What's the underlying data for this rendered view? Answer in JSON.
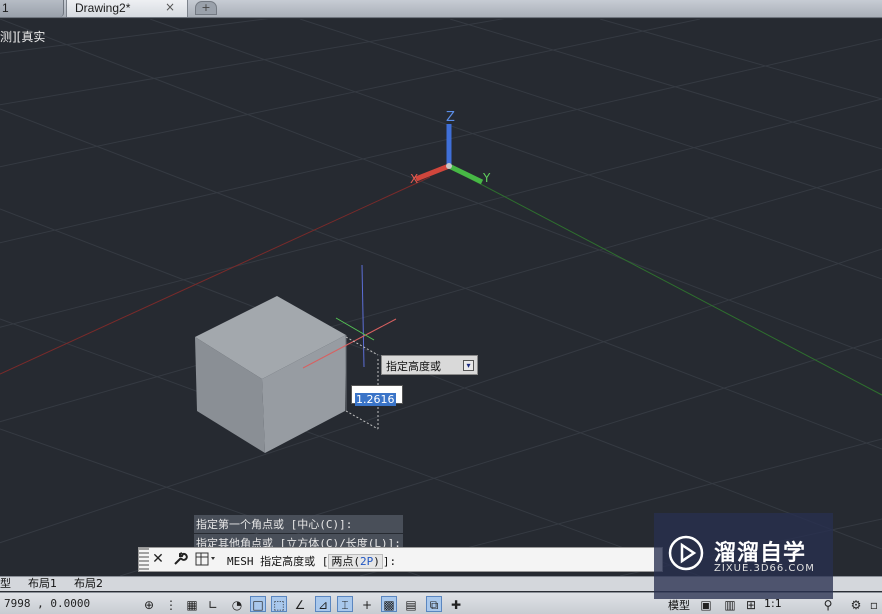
{
  "tabs": {
    "tab1_label": "1",
    "tab2_label": "Drawing2*",
    "close_glyph": "×",
    "new_glyph": "+"
  },
  "viewport": {
    "view_label": "测][真实",
    "axis_labels": {
      "x": "X",
      "y": "Y",
      "z": "Z"
    },
    "tooltip_text": "指定高度或",
    "tooltip_arrow": "▾",
    "dynamic_input_value": "1.2616"
  },
  "command_history": [
    "指定第一个角点或 [中心(C)]:",
    "指定其他角点或 [立方体(C)/长度(L)]:"
  ],
  "command_line": {
    "close_glyph": "✕",
    "wrench_glyph": "🔧",
    "prompt_prefix": "MESH 指定高度或 [",
    "option_label": "两点(",
    "option_key": "2P",
    "option_close": ")",
    "prompt_suffix": "]:"
  },
  "layout_tabs": {
    "model": "型",
    "layout1": "布局1",
    "layout2": "布局2"
  },
  "status_bar": {
    "coordinates": "7998   , 0.0000",
    "model_label": "模型",
    "scale_label": "1:1"
  },
  "watermark": {
    "title": "溜溜自学",
    "url": "ZIXUE.3D66.COM"
  },
  "colors": {
    "viewport_bg": "#262a31",
    "x_axis": "#d0463c",
    "y_axis": "#47b845",
    "z_axis": "#3f6fd8",
    "box_face": "#8f9499"
  }
}
